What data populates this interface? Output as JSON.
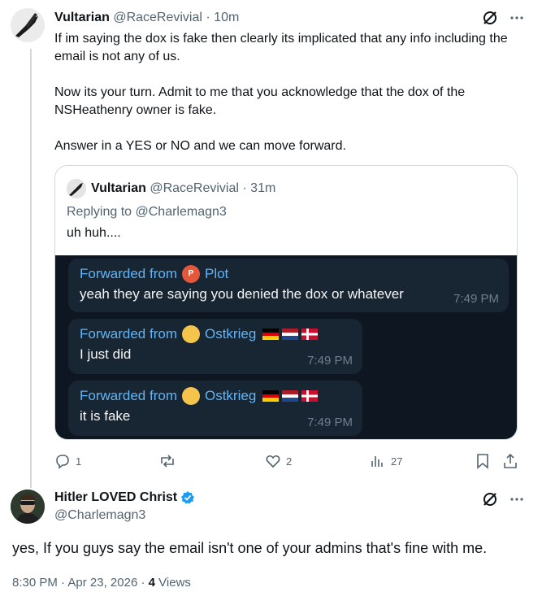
{
  "reply": {
    "name": "Vultarian",
    "handle": "@RaceRevivial",
    "separator": "·",
    "time": "10m",
    "paragraphs": [
      "If im saying the dox is fake then clearly its implicated that any info including the email is not any of us.",
      "Now its your turn. Admit to me that you acknowledge that the dox of the NSHeathenry owner is fake.",
      "Answer in a YES or NO and we can move forward."
    ],
    "quote": {
      "name": "Vultarian",
      "handle": "@RaceRevivial",
      "separator": "·",
      "time": "31m",
      "replying_to": "Replying to @Charlemagn3",
      "text": "uh huh....",
      "telegram": {
        "messages": [
          {
            "forwarded_label": "Forwarded from",
            "from": "Plot",
            "chip": "P",
            "text": "yeah they are saying you denied the dox or whatever",
            "time": "7:49 PM"
          },
          {
            "forwarded_label": "Forwarded from",
            "from": "Ostkrieg",
            "text": "I just did",
            "time": "7:49 PM"
          },
          {
            "forwarded_label": "Forwarded from",
            "from": "Ostkrieg",
            "text": "it is fake",
            "time": "7:49 PM"
          }
        ]
      }
    },
    "stats": {
      "replies": "1",
      "reposts": "",
      "likes": "2",
      "views": "27"
    }
  },
  "main": {
    "name": "Hitler LOVED Christ",
    "handle": "@Charlemagn3",
    "text": "yes, If you guys say the email isn't one of your admins that's fine with me.",
    "time": "8:30 PM",
    "separator": "·",
    "date": "Apr 23, 2026",
    "views_count": "4",
    "views_label": "Views"
  },
  "colors": {
    "text": "#0f1419",
    "muted": "#536471",
    "verified": "#1d9bf0",
    "telegram_bg": "#0e1621",
    "telegram_bubble": "#182533",
    "telegram_link": "#5eb5f7"
  }
}
